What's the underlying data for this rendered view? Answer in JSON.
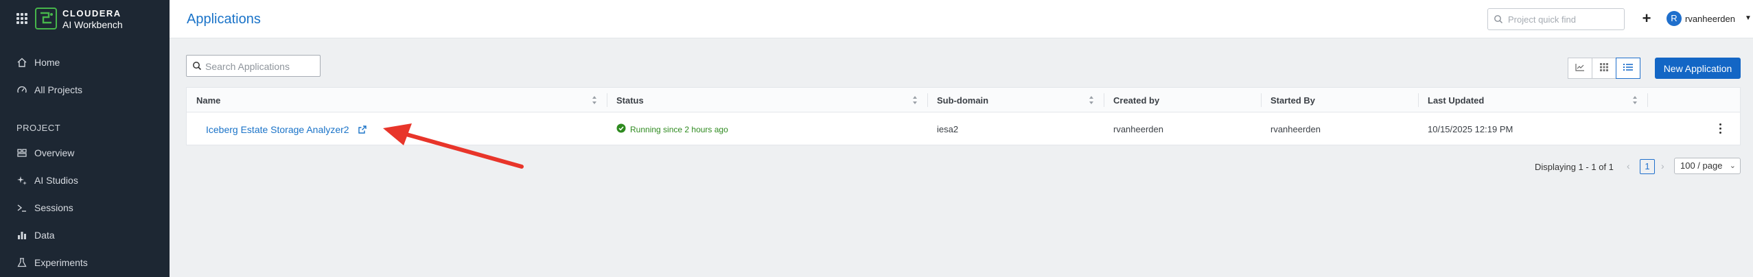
{
  "sidebar": {
    "brand_line1": "CLOUDERA",
    "brand_line2": "AI Workbench",
    "items": [
      {
        "label": "Home",
        "icon": "home-icon"
      },
      {
        "label": "All Projects",
        "icon": "gauge-icon"
      }
    ],
    "section_label": "PROJECT",
    "project_items": [
      {
        "label": "Overview",
        "icon": "overview-icon"
      },
      {
        "label": "AI Studios",
        "icon": "sparkle-icon"
      },
      {
        "label": "Sessions",
        "icon": "terminal-icon"
      },
      {
        "label": "Data",
        "icon": "bar-chart-icon"
      },
      {
        "label": "Experiments",
        "icon": "flask-icon"
      }
    ]
  },
  "header": {
    "title": "Applications",
    "quick_find_placeholder": "Project quick find",
    "plus_label": "+",
    "avatar_letter": "R",
    "username": "rvanheerden"
  },
  "toolbar": {
    "search_placeholder": "Search Applications",
    "new_button_label": "New Application"
  },
  "table": {
    "columns": [
      "Name",
      "Status",
      "Sub-domain",
      "Created by",
      "Started By",
      "Last Updated"
    ],
    "rows": [
      {
        "name": "Iceberg Estate Storage Analyzer2",
        "status": "Running since 2 hours ago",
        "subdomain": "iesa2",
        "created_by": "rvanheerden",
        "started_by": "rvanheerden",
        "last_updated": "10/15/2025 12:19 PM"
      }
    ]
  },
  "pagination": {
    "displaying": "Displaying 1 - 1 of 1",
    "current_page": "1",
    "page_size": "100 / page"
  },
  "colors": {
    "accent": "#1366c5",
    "sidebar_bg": "#1d2733",
    "status_ok": "#2e8a1f",
    "annotation_arrow": "#e8352a"
  }
}
